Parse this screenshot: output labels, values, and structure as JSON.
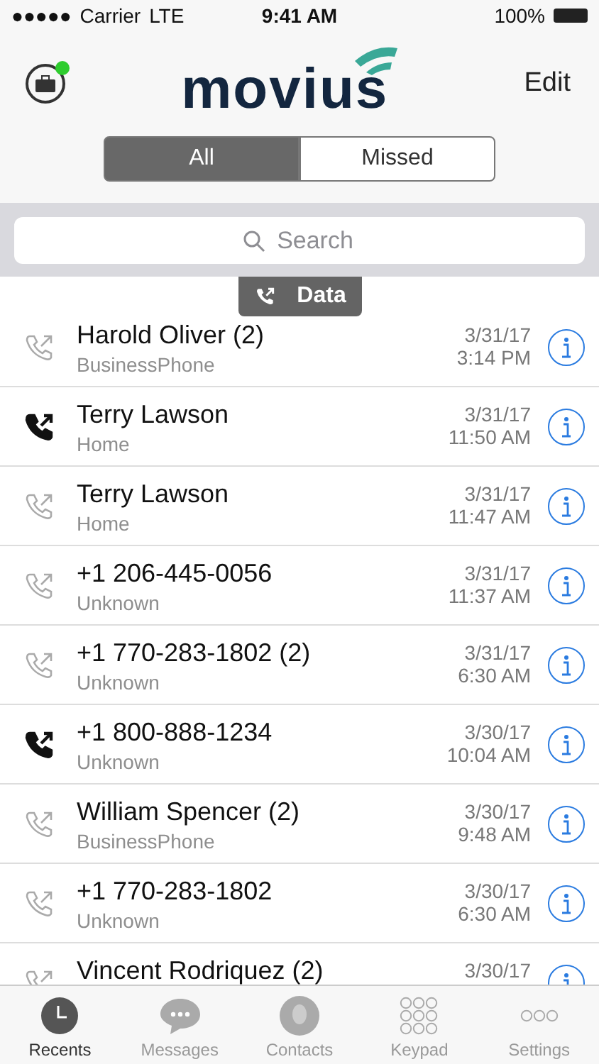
{
  "status_bar": {
    "signal_dots": "●●●●●",
    "carrier": "Carrier",
    "network": "LTE",
    "time": "9:41 AM",
    "battery": "100%"
  },
  "header": {
    "logo": "movius",
    "edit": "Edit"
  },
  "tabs": [
    {
      "label": "All",
      "selected": true
    },
    {
      "label": "Missed",
      "selected": false
    }
  ],
  "search": {
    "placeholder": "Search"
  },
  "line_tab": {
    "label": "Data"
  },
  "calls": [
    {
      "name": "Harold Oliver  (2)",
      "type": "BusinessPhone",
      "date": "3/31/17",
      "time": "3:14 PM",
      "kind": "outgoing"
    },
    {
      "name": "Terry Lawson",
      "type": "Home",
      "date": "3/31/17",
      "time": "11:50 AM",
      "kind": "incoming"
    },
    {
      "name": "Terry Lawson",
      "type": "Home",
      "date": "3/31/17",
      "time": "11:47 AM",
      "kind": "outgoing"
    },
    {
      "name": "+1 206-445-0056",
      "type": "Unknown",
      "date": "3/31/17",
      "time": "11:37 AM",
      "kind": "outgoing"
    },
    {
      "name": "+1 770-283-1802  (2)",
      "type": "Unknown",
      "date": "3/31/17",
      "time": "6:30 AM",
      "kind": "outgoing"
    },
    {
      "name": "+1 800-888-1234",
      "type": "Unknown",
      "date": "3/30/17",
      "time": "10:04 AM",
      "kind": "incoming"
    },
    {
      "name": "William Spencer  (2)",
      "type": "BusinessPhone",
      "date": "3/30/17",
      "time": "9:48 AM",
      "kind": "outgoing"
    },
    {
      "name": "+1 770-283-1802",
      "type": "Unknown",
      "date": "3/30/17",
      "time": "6:30 AM",
      "kind": "outgoing"
    },
    {
      "name": "Vincent Rodriquez  (2)",
      "date": "3/30/17",
      "kind": "outgoing"
    }
  ],
  "tab_bar": [
    {
      "label": "Recents",
      "kind": "clock",
      "selected": true
    },
    {
      "label": "Messages",
      "kind": "bubble",
      "selected": false
    },
    {
      "label": "Contacts",
      "kind": "person",
      "selected": false
    },
    {
      "label": "Keypad",
      "kind": "keypad",
      "selected": false
    },
    {
      "label": "Settings",
      "kind": "dots",
      "selected": false
    }
  ]
}
